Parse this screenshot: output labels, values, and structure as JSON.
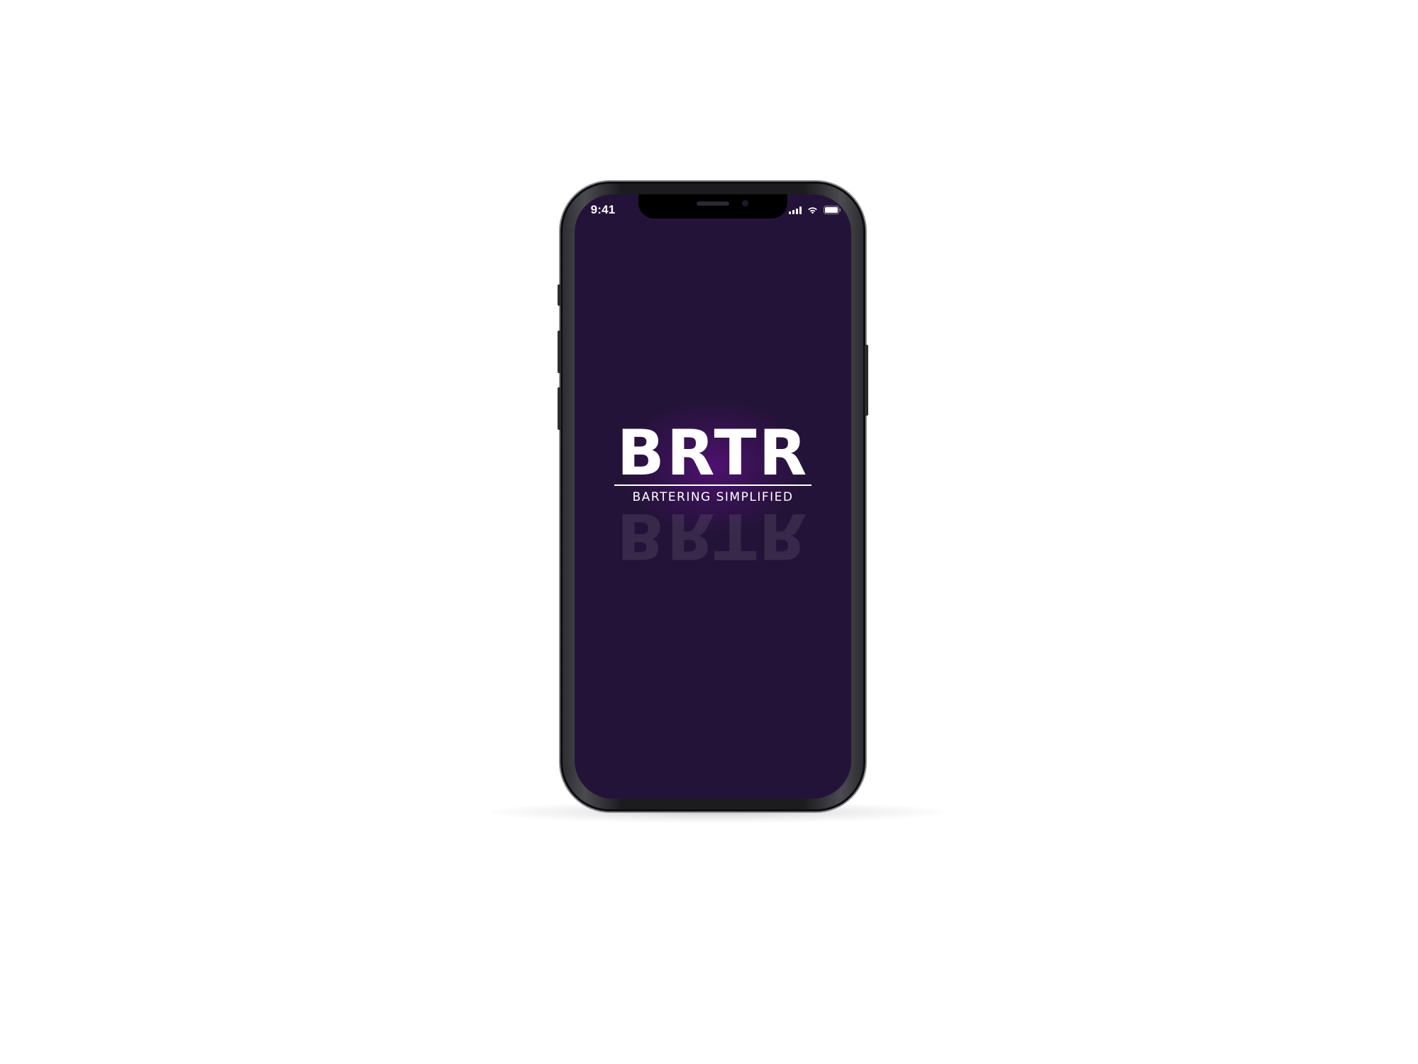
{
  "status_bar": {
    "time": "9:41"
  },
  "splash": {
    "logo_text": "BRTR",
    "tagline": "BARTERING SIMPLIFIED",
    "reflection_text": "BRTR"
  },
  "colors": {
    "background": "#241338",
    "glow": "#4f1170",
    "text": "#ffffff"
  },
  "icons": [
    "signal-icon",
    "wifi-icon",
    "battery-icon"
  ]
}
